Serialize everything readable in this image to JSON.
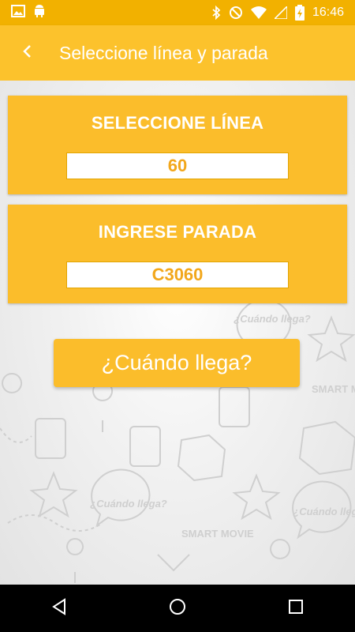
{
  "status_bar": {
    "time": "16:46"
  },
  "header": {
    "title": "Seleccione línea y parada"
  },
  "line_card": {
    "title": "SELECCIONE LÍNEA",
    "value": "60"
  },
  "stop_card": {
    "title": "INGRESE PARADA",
    "value": "C3060"
  },
  "cta": {
    "label": "¿Cuándo llega?"
  },
  "background_marks": {
    "bubble_text": "¿Cuándo llega?",
    "brand_text": "SMART MOVIE"
  },
  "colors": {
    "accent": "#fcc22c",
    "status_bar": "#f2b100",
    "value_text": "#f2a71b"
  },
  "icons": [
    "image-icon",
    "android-icon",
    "bluetooth-icon",
    "do-not-disturb-icon",
    "wifi-icon",
    "signal-icon",
    "battery-icon",
    "back-arrow-icon",
    "nav-back-icon",
    "nav-home-icon",
    "nav-recents-icon"
  ]
}
